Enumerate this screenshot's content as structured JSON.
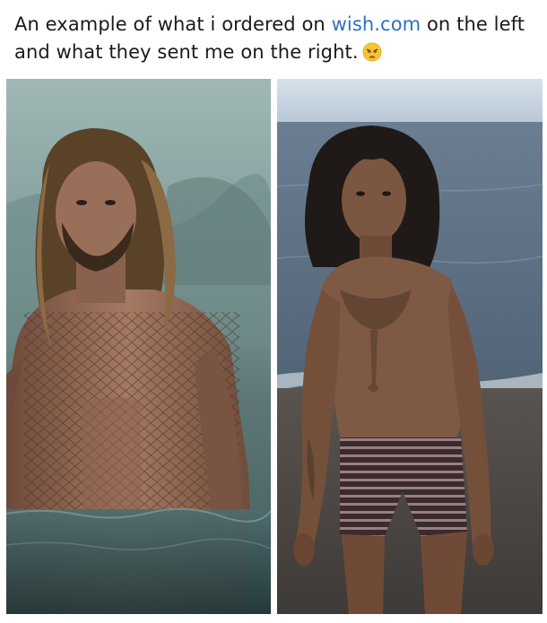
{
  "caption": {
    "line1_prefix": "An example of what i ordered on ",
    "line1_site": "wish.com",
    "line1_suffix": " on the left",
    "line2": "and what they sent me on the right.",
    "emoji_icon": "weary-face-icon"
  },
  "photos": {
    "left": {
      "depicts": "ordered"
    },
    "right": {
      "depicts": "received"
    }
  },
  "colors": {
    "site_link": "#2f6fbf",
    "text": "#1a1a1a"
  }
}
